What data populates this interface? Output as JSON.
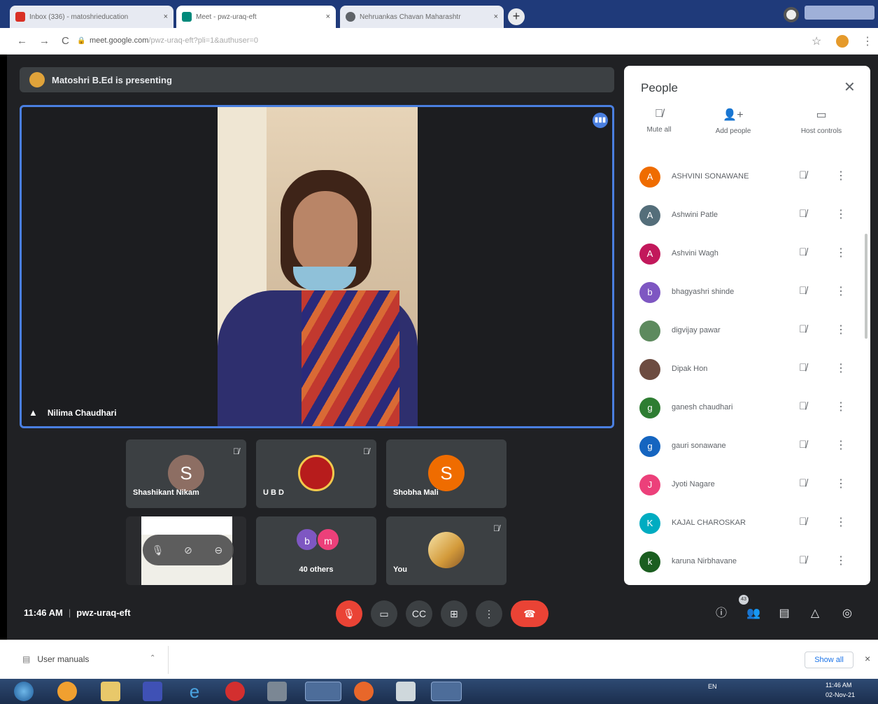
{
  "browser": {
    "tabs": [
      {
        "label": "Inbox (336) - matoshrieducation",
        "close": "×",
        "favicon_color": "#d93025"
      },
      {
        "label": "Meet - pwz-uraq-eft",
        "close": "×",
        "favicon_color": "#00897b"
      },
      {
        "label": "Nehruankas Chavan Maharashtr",
        "close": "×",
        "favicon_color": "#5f6368"
      }
    ],
    "new_tab": "+",
    "url_host": "meet.google.com",
    "url_path": "/pwz-uraq-eft?pli=1&authuser=0",
    "nav": {
      "back": "←",
      "forward": "→",
      "reload": "C",
      "lock": "🔒"
    },
    "star": "☆",
    "menu": "⋮"
  },
  "meet": {
    "presenting_text": "Matoshri B.Ed is presenting",
    "main_speaker": "Nilima Chaudhari",
    "tiles": [
      {
        "name": "Shashikant Nikam",
        "initial": "S",
        "color": "#8d6e63"
      },
      {
        "name": "U B D",
        "initial": "",
        "color": "#b71c1c"
      },
      {
        "name": "Shobha Mali",
        "initial": "S",
        "color": "#ef6c00"
      }
    ],
    "others_label": "40 others",
    "others_avatars": [
      {
        "initial": "b",
        "color": "#7e57c2"
      },
      {
        "initial": "m",
        "color": "#ec407a"
      }
    ],
    "you_label": "You",
    "time": "11:46 AM",
    "meeting_code": "pwz-uraq-eft",
    "participants_badge": "43"
  },
  "people_panel": {
    "title": "People",
    "actions": [
      {
        "label": "Mute all",
        "icon": "mic-off-icon"
      },
      {
        "label": "Add people",
        "icon": "add-person-icon"
      },
      {
        "label": "Host controls",
        "icon": "host-controls-icon"
      }
    ],
    "participants": [
      {
        "name": "ASHVINI SONAWANE",
        "initial": "A",
        "color": "#ef6c00"
      },
      {
        "name": "Ashwini Patle",
        "initial": "A",
        "color": "#546e7a"
      },
      {
        "name": "Ashvini Wagh",
        "initial": "A",
        "color": "#c2185b"
      },
      {
        "name": "bhagyashri shinde",
        "initial": "b",
        "color": "#7e57c2"
      },
      {
        "name": "digvijay pawar",
        "initial": "",
        "color": "#5d8a5e"
      },
      {
        "name": "Dipak Hon",
        "initial": "",
        "color": "#6d4c41"
      },
      {
        "name": "ganesh chaudhari",
        "initial": "g",
        "color": "#2e7d32"
      },
      {
        "name": "gauri sonawane",
        "initial": "g",
        "color": "#1565c0"
      },
      {
        "name": "Jyoti Nagare",
        "initial": "J",
        "color": "#ec407a"
      },
      {
        "name": "KAJAL CHAROSKAR",
        "initial": "K",
        "color": "#00acc1"
      },
      {
        "name": "karuna Nirbhavane",
        "initial": "k",
        "color": "#1b5e20"
      }
    ]
  },
  "download_bar": {
    "file": "User manuals",
    "show_all": "Show all",
    "close": "×"
  },
  "taskbar": {
    "time": "11:46 AM",
    "date": "02-Nov-21",
    "lang": "EN"
  }
}
